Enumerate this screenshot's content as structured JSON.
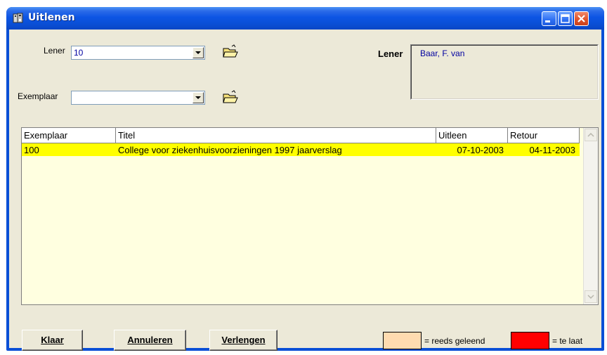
{
  "window": {
    "title": "Uitlenen"
  },
  "form": {
    "lener_label": "Lener",
    "lener_value": "10",
    "exemplaar_label": "Exemplaar",
    "exemplaar_value": "",
    "info_label": "Lener",
    "info_value": "Baar, F. van"
  },
  "table": {
    "columns": [
      "Exemplaar",
      "Titel",
      "Uitleen",
      "Retour"
    ],
    "rows": [
      {
        "exemplaar": "100",
        "titel": "College voor ziekenhuisvoorzieningen 1997 jaarverslag",
        "uitleen": "07-10-2003",
        "retour": "04-11-2003"
      }
    ]
  },
  "buttons": {
    "klaar": "Klaar",
    "annuleren": "Annuleren",
    "verlengen": "Verlengen"
  },
  "legend": {
    "reeds_geleend_label": "= reeds geleend",
    "te_laat_label": "= te laat"
  },
  "colors": {
    "reeds_geleend": "#ffdbb0",
    "te_laat": "#ff0000",
    "selected_row": "#ffff00",
    "grid_bg": "#ffffe0"
  },
  "icons": {
    "title": "library-icon",
    "lener_lookup": "open-folder-icon",
    "exemplaar_lookup": "open-folder-icon"
  }
}
